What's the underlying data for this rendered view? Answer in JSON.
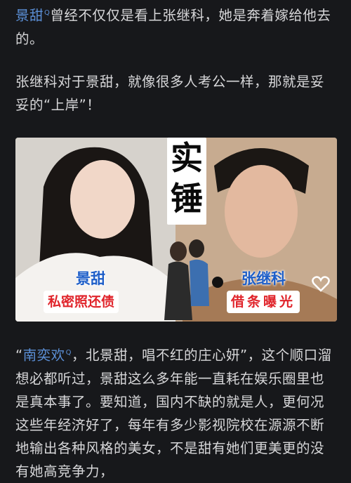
{
  "intro": {
    "link_name": "景甜",
    "text": "曾经不仅仅是看上张继科，她是奔着嫁给他去的。"
  },
  "para2": {
    "text": "张继科对于景甜，就像很多人考公一样，那就是妥妥的“上岸”！"
  },
  "image": {
    "headline_line1": "实",
    "headline_line2": "锤",
    "left_name": "景甜",
    "left_caption": "私密照还债",
    "right_name": "张继科",
    "right_caption": "借条曝光",
    "heart_icon": "heart-outline-icon"
  },
  "para3": {
    "open_quote": "“",
    "link_name": "南奕欢",
    "text": "，北景甜，唱不红的庄心妍”，这个顺口溜想必都听过，景甜这么多年能一直耗在娱乐圈里也是真本事了。要知道，国内不缺的就是人，更何况这些年经济好了，每年有多少影视院校在源源不断地输出各种风格的美女，不是甜有她们更美更的没有她高竞争力，"
  },
  "colors": {
    "background": "#17181b",
    "text": "#d7d7d9",
    "link": "#5b8fd6",
    "caption_red": "#e0242b",
    "name_blue": "#1d5ec8"
  }
}
